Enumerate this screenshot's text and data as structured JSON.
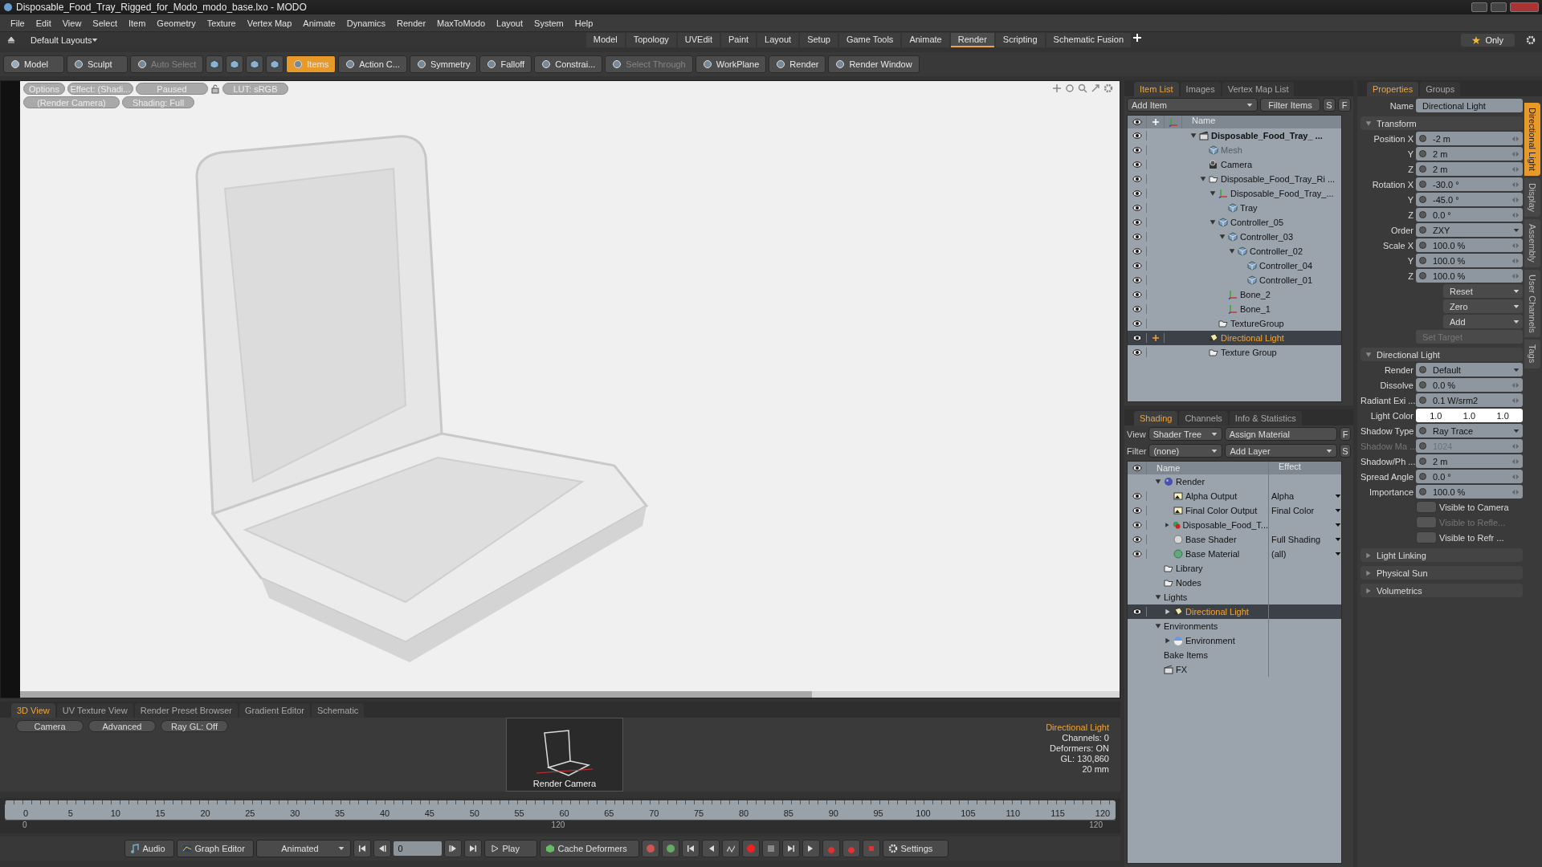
{
  "window": {
    "title": "Disposable_Food_Tray_Rigged_for_Modo_modo_base.lxo - MODO"
  },
  "menu": [
    "File",
    "Edit",
    "View",
    "Select",
    "Item",
    "Geometry",
    "Texture",
    "Vertex Map",
    "Animate",
    "Dynamics",
    "Render",
    "MaxToModo",
    "Layout",
    "System",
    "Help"
  ],
  "layout_bar": {
    "layouts": "Default Layouts",
    "only": "Only",
    "tabs": [
      {
        "label": "Model",
        "selected": false
      },
      {
        "label": "Topology",
        "selected": false
      },
      {
        "label": "UVEdit",
        "selected": false
      },
      {
        "label": "Paint",
        "selected": false
      },
      {
        "label": "Layout",
        "selected": false
      },
      {
        "label": "Setup",
        "selected": false
      },
      {
        "label": "Game Tools",
        "selected": false
      },
      {
        "label": "Animate",
        "selected": false
      },
      {
        "label": "Render",
        "selected": true
      },
      {
        "label": "Scripting",
        "selected": false
      },
      {
        "label": "Schematic Fusion",
        "selected": false
      }
    ]
  },
  "toolbar": [
    {
      "label": "Model",
      "kind": "mode",
      "selected": false,
      "disabled": false
    },
    {
      "label": "Sculpt",
      "kind": "mode",
      "selected": false,
      "disabled": false
    },
    {
      "label": "Auto Select",
      "kind": "tool",
      "selected": false,
      "disabled": true
    },
    {
      "label": "Items",
      "kind": "tool",
      "selected": true,
      "disabled": false
    },
    {
      "label": "Action C...",
      "kind": "tool",
      "selected": false,
      "disabled": false
    },
    {
      "label": "Symmetry",
      "kind": "tool",
      "selected": false,
      "disabled": false
    },
    {
      "label": "Falloff",
      "kind": "tool",
      "selected": false,
      "disabled": false
    },
    {
      "label": "Constrai...",
      "kind": "tool",
      "selected": false,
      "disabled": false
    },
    {
      "label": "Select Through",
      "kind": "tool",
      "selected": false,
      "disabled": true
    },
    {
      "label": "WorkPlane",
      "kind": "tool",
      "selected": false,
      "disabled": false
    },
    {
      "label": "Render",
      "kind": "tool",
      "selected": false,
      "disabled": false
    },
    {
      "label": "Render Window",
      "kind": "tool",
      "selected": false,
      "disabled": false
    }
  ],
  "viewport": {
    "overlay_row_1": [
      "Options",
      "Effect: (Shadi...",
      "Paused",
      "LUT: sRGB"
    ],
    "overlay_row_2": [
      "(Render Camera)",
      "Shading: Full"
    ]
  },
  "item_list": {
    "tabs": [
      {
        "label": "Item List",
        "selected": true
      },
      {
        "label": "Images",
        "selected": false
      },
      {
        "label": "Vertex Map List",
        "selected": false
      }
    ],
    "add_item": "Add Item",
    "filter": "Filter Items",
    "s": "S",
    "f": "F",
    "column": "Name",
    "tree": [
      {
        "name": "Disposable_Food_Tray_ ...",
        "kind": "scene",
        "bold": true,
        "dimmed": false,
        "selected": false,
        "expanded": true,
        "children": [
          {
            "name": "Mesh",
            "kind": "mesh",
            "bold": false,
            "dimmed": true,
            "selected": false
          },
          {
            "name": "Camera",
            "kind": "camera",
            "bold": false,
            "dimmed": false,
            "selected": false
          },
          {
            "name": "Disposable_Food_Tray_Ri ...",
            "kind": "folder",
            "bold": false,
            "dimmed": false,
            "selected": false,
            "expanded": true,
            "children": [
              {
                "name": "Disposable_Food_Tray_...",
                "kind": "locator",
                "bold": false,
                "dimmed": false,
                "selected": false,
                "expanded": true,
                "children": [
                  {
                    "name": "Tray",
                    "kind": "mesh",
                    "bold": false,
                    "dimmed": false,
                    "selected": false
                  }
                ]
              },
              {
                "name": "Controller_05",
                "kind": "mesh",
                "bold": false,
                "dimmed": false,
                "selected": false,
                "expanded": true,
                "children": [
                  {
                    "name": "Controller_03",
                    "kind": "mesh",
                    "bold": false,
                    "dimmed": false,
                    "selected": false,
                    "expanded": true,
                    "children": [
                      {
                        "name": "Controller_02",
                        "kind": "mesh",
                        "bold": false,
                        "dimmed": false,
                        "selected": false,
                        "expanded": true,
                        "children": [
                          {
                            "name": "Controller_04",
                            "kind": "mesh",
                            "bold": false,
                            "dimmed": false,
                            "selected": false
                          },
                          {
                            "name": "Controller_01",
                            "kind": "mesh",
                            "bold": false,
                            "dimmed": false,
                            "selected": false
                          }
                        ]
                      }
                    ]
                  },
                  {
                    "name": "Bone_2",
                    "kind": "locator",
                    "bold": false,
                    "dimmed": false,
                    "selected": false
                  },
                  {
                    "name": "Bone_1",
                    "kind": "locator",
                    "bold": false,
                    "dimmed": false,
                    "selected": false
                  }
                ]
              },
              {
                "name": "TextureGroup",
                "kind": "folder",
                "bold": false,
                "dimmed": false,
                "selected": false
              }
            ]
          },
          {
            "name": "Directional Light",
            "kind": "light",
            "bold": false,
            "dimmed": false,
            "selected": true
          },
          {
            "name": "Texture Group",
            "kind": "folder",
            "bold": false,
            "dimmed": false,
            "selected": false
          }
        ]
      }
    ]
  },
  "shading": {
    "tabs": [
      {
        "label": "Shading",
        "selected": true
      },
      {
        "label": "Channels",
        "selected": false
      },
      {
        "label": "Info & Statistics",
        "selected": false
      }
    ],
    "view_label": "View",
    "view": "Shader Tree",
    "assign": "Assign Material",
    "f": "F",
    "filter_label": "Filter",
    "filter": "(none)",
    "add_layer": "Add Layer",
    "s": "S",
    "columns": [
      "Name",
      "Effect"
    ],
    "tree": [
      {
        "name": "Render",
        "kind": "render",
        "visible": false,
        "selected": false,
        "expanded": true,
        "children": [
          {
            "name": "Alpha Output",
            "kind": "output",
            "visible": true,
            "selected": false,
            "effect": "Alpha"
          },
          {
            "name": "Final Color Output",
            "kind": "output",
            "visible": true,
            "selected": false,
            "effect": "Final Color"
          },
          {
            "name": "Disposable_Food_T...",
            "kind": "group",
            "visible": true,
            "selected": false,
            "expanded": false,
            "has_effect_menu": true
          },
          {
            "name": "Base Shader",
            "kind": "shader",
            "visible": true,
            "selected": false,
            "effect": "Full Shading"
          },
          {
            "name": "Base Material",
            "kind": "material",
            "visible": true,
            "selected": false,
            "effect": "(all)"
          }
        ]
      },
      {
        "name": "Library",
        "kind": "folder",
        "visible": false,
        "selected": false
      },
      {
        "name": "Nodes",
        "kind": "folder",
        "visible": false,
        "selected": false
      },
      {
        "name": "Lights",
        "kind": "plain",
        "visible": false,
        "selected": false,
        "expanded": true,
        "children": [
          {
            "name": "Directional Light",
            "kind": "light",
            "visible": true,
            "selected": true,
            "expanded": false
          }
        ]
      },
      {
        "name": "Environments",
        "kind": "plain",
        "visible": false,
        "selected": false,
        "expanded": true,
        "children": [
          {
            "name": "Environment",
            "kind": "environment",
            "visible": false,
            "selected": false,
            "expanded": false
          }
        ]
      },
      {
        "name": "Bake Items",
        "kind": "plain",
        "visible": false,
        "selected": false
      },
      {
        "name": "FX",
        "kind": "fx",
        "visible": false,
        "selected": false
      }
    ]
  },
  "properties": {
    "tabs": [
      {
        "label": "Properties",
        "selected": true
      },
      {
        "label": "Groups",
        "selected": false
      }
    ],
    "name_label": "Name",
    "name": "Directional Light",
    "side_tabs": [
      {
        "label": "Directional Light",
        "selected": true
      },
      {
        "label": "Display",
        "selected": false
      },
      {
        "label": "Assembly",
        "selected": false
      },
      {
        "label": "User Channels",
        "selected": false
      },
      {
        "label": "Tags",
        "selected": false
      }
    ],
    "sections": [
      {
        "title": "Transform",
        "expanded": true,
        "rows": [
          {
            "label": "Position X",
            "value": "-2 m",
            "kind": "number",
            "disabled": false
          },
          {
            "label": "Y",
            "value": "2 m",
            "kind": "number",
            "disabled": false
          },
          {
            "label": "Z",
            "value": "2 m",
            "kind": "number",
            "disabled": false
          },
          {
            "label": "Rotation X",
            "value": "-30.0 °",
            "kind": "number",
            "disabled": false
          },
          {
            "label": "Y",
            "value": "-45.0 °",
            "kind": "number",
            "disabled": false
          },
          {
            "label": "Z",
            "value": "0.0 °",
            "kind": "number",
            "disabled": false
          },
          {
            "label": "Order",
            "value": "ZXY",
            "kind": "dropdown",
            "disabled": false
          },
          {
            "label": "Scale X",
            "value": "100.0 %",
            "kind": "number",
            "disabled": false
          },
          {
            "label": "Y",
            "value": "100.0 %",
            "kind": "number",
            "disabled": false
          },
          {
            "label": "Z",
            "value": "100.0 %",
            "kind": "number",
            "disabled": false
          },
          {
            "value": "Reset",
            "kind": "menu",
            "disabled": false
          },
          {
            "value": "Zero",
            "kind": "menu",
            "disabled": false
          },
          {
            "value": "Add",
            "kind": "menu",
            "disabled": false
          },
          {
            "value": "Set Target",
            "kind": "button",
            "disabled": true
          }
        ]
      },
      {
        "title": "Directional Light",
        "expanded": true,
        "rows": [
          {
            "label": "Render",
            "value": "Default",
            "kind": "dropdown",
            "disabled": false
          },
          {
            "label": "Dissolve",
            "value": "0.0 %",
            "kind": "number",
            "disabled": false
          },
          {
            "label": "Radiant Exi ...",
            "value": "0.1 W/srm2",
            "kind": "number_menu",
            "disabled": false
          },
          {
            "label": "Light Color",
            "values": [
              "1.0",
              "1.0",
              "1.0"
            ],
            "kind": "color",
            "disabled": false
          },
          {
            "label": "Shadow Type",
            "value": "Ray Trace",
            "kind": "dropdown",
            "disabled": false
          },
          {
            "label": "Shadow Ma ...",
            "value": "1024",
            "kind": "number_menu",
            "disabled": true
          },
          {
            "label": "Shadow/Ph ...",
            "value": "2 m",
            "kind": "number",
            "disabled": false
          },
          {
            "label": "Spread Angle",
            "value": "0.0 °",
            "kind": "number",
            "disabled": false
          },
          {
            "label": "Importance",
            "value": "100.0 %",
            "kind": "number",
            "disabled": false
          },
          {
            "value": "Visible to Camera",
            "kind": "toggle",
            "disabled": false,
            "on": false
          },
          {
            "value": "Visible to Refle...",
            "kind": "toggle",
            "disabled": true,
            "on": false
          },
          {
            "value": "Visible to Refr ...",
            "kind": "toggle",
            "disabled": false,
            "on": false
          }
        ]
      },
      {
        "title": "Light Linking",
        "expanded": false
      },
      {
        "title": "Physical Sun",
        "expanded": false
      },
      {
        "title": "Volumetrics",
        "expanded": false
      }
    ]
  },
  "bottom": {
    "tabs": [
      {
        "label": "3D View",
        "selected": true
      },
      {
        "label": "UV Texture View",
        "selected": false
      },
      {
        "label": "Render Preset Browser",
        "selected": false
      },
      {
        "label": "Gradient Editor",
        "selected": false
      },
      {
        "label": "Schematic",
        "selected": false
      }
    ],
    "buttons": [
      "Camera",
      "Advanced",
      "Ray GL: Off"
    ],
    "thumbnail_label": "Render Camera",
    "info": [
      "Directional Light",
      "Channels: 0",
      "Deformers: ON",
      "GL: 130,860",
      "20 mm"
    ]
  },
  "timeline": {
    "ticks": [
      "0",
      "5",
      "10",
      "15",
      "20",
      "25",
      "30",
      "35",
      "40",
      "45",
      "50",
      "55",
      "60",
      "65",
      "70",
      "75",
      "80",
      "85",
      "90",
      "95",
      "100",
      "105",
      "110",
      "115",
      "120"
    ],
    "range": [
      "0",
      "120",
      "120"
    ]
  },
  "transport": {
    "audio": "Audio",
    "graph_editor": "Graph Editor",
    "animated": "Animated",
    "frame": "0",
    "play": "Play",
    "cache": "Cache Deformers",
    "settings": "Settings"
  }
}
